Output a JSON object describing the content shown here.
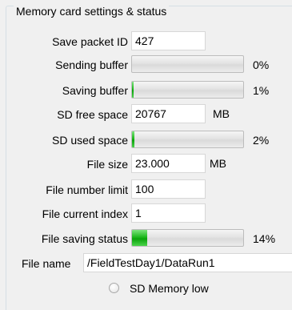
{
  "group": {
    "title": "Memory card settings & status"
  },
  "save_packet": {
    "label": "Save packet ID",
    "value": "427"
  },
  "sending_buffer": {
    "label": "Sending buffer",
    "percent": 0,
    "percent_text": "0%"
  },
  "saving_buffer": {
    "label": "Saving buffer",
    "percent": 1,
    "percent_text": "1%"
  },
  "sd_free": {
    "label": "SD free space",
    "value": "20767",
    "unit": "MB"
  },
  "sd_used": {
    "label": "SD used space",
    "percent": 2,
    "percent_text": "2%"
  },
  "file_size": {
    "label": "File size",
    "value": "23.000",
    "unit": "MB"
  },
  "file_number_limit": {
    "label": "File number limit",
    "value": "100"
  },
  "file_current_index": {
    "label": "File current index",
    "value": "1"
  },
  "file_saving_status": {
    "label": "File saving status",
    "percent": 14,
    "percent_text": "14%"
  },
  "file_name": {
    "label": "File name",
    "value": "/FieldTestDay1/DataRun1"
  },
  "sd_memory_low": {
    "label": "SD Memory low",
    "checked": false
  },
  "colors": {
    "progress_fill": "#13b313",
    "field_border": "#d7d7d7",
    "background": "#f0f0f0"
  }
}
